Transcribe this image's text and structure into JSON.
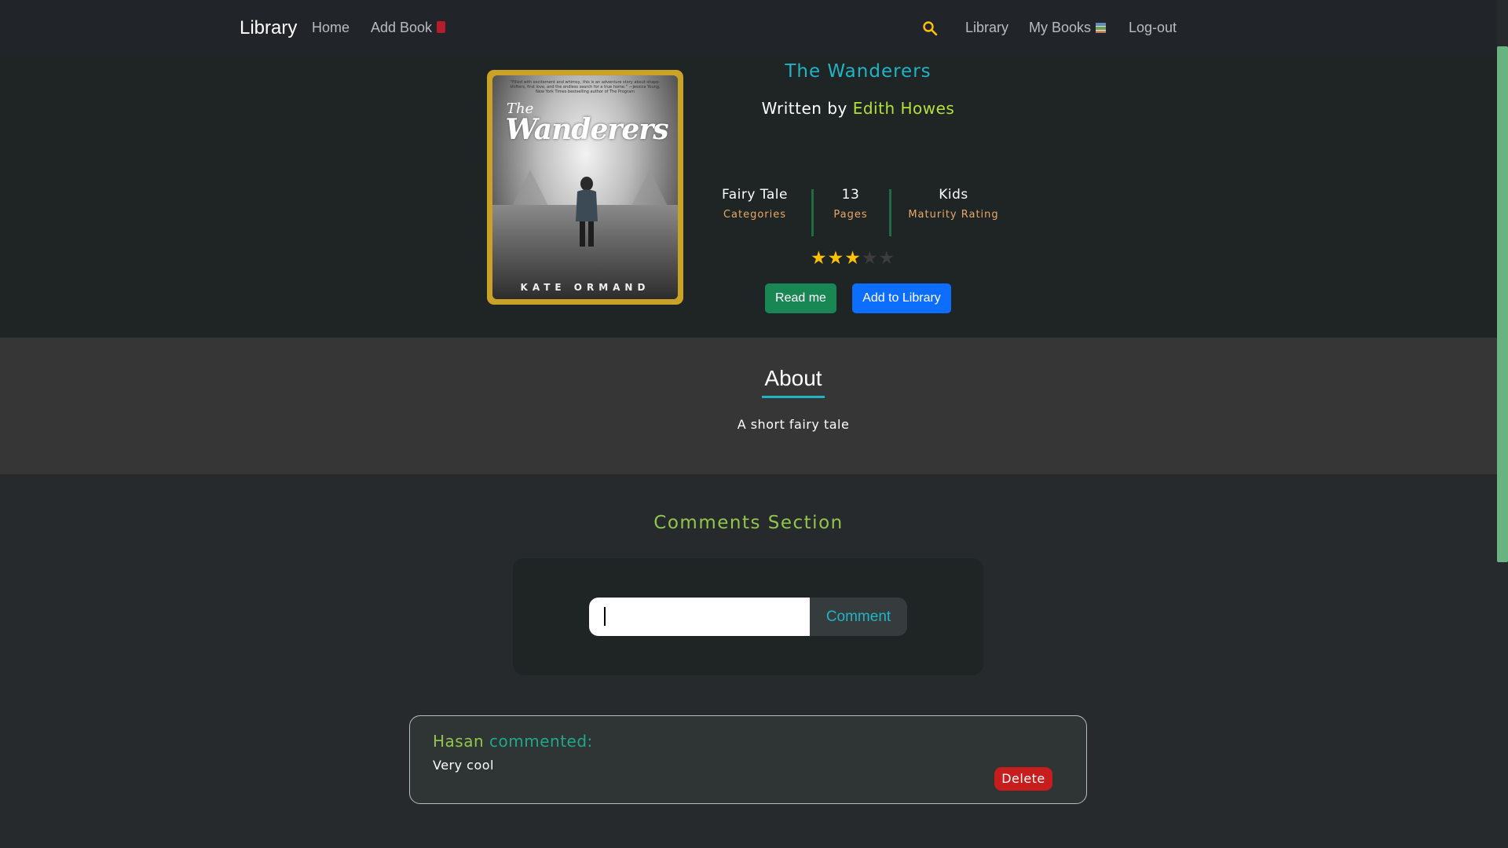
{
  "navbar": {
    "brand": "Library",
    "home": "Home",
    "add_book": "Add Book",
    "library": "Library",
    "my_books": "My Books",
    "logout": "Log-out",
    "search_icon": "search-icon",
    "accent_color": "#ffc107"
  },
  "book": {
    "cover": {
      "blurb": "\"Filled with excitement and whimsy, this is an adventure story about shape-shifters, first love, and the endless search for a true home.\" —Jessica Young, New York Times bestselling author of The Program",
      "title_prefix": "The",
      "title": "Wanderers",
      "author": "KATE ORMAND"
    },
    "title": "The Wanderers",
    "written_by_prefix": "Written by",
    "author": "Edith Howes",
    "stats": {
      "category_value": "Fairy Tale",
      "category_label": "Categories",
      "pages_value": "13",
      "pages_label": "Pages",
      "maturity_value": "Kids",
      "maturity_label": "Maturity Rating"
    },
    "rating": {
      "filled": 3,
      "max": 5
    },
    "read_button": "Read me",
    "add_button": "Add to Library"
  },
  "about": {
    "title": "About",
    "text": "A short fairy tale"
  },
  "comments": {
    "title": "Comments Section",
    "input_value": "",
    "button": "Comment",
    "items": [
      {
        "user": "Hasan",
        "action": "commented:",
        "text": "Very cool",
        "delete": "Delete"
      }
    ]
  },
  "colors": {
    "title_teal": "#1fb5c4",
    "author_lime": "#b4e23a",
    "read_green": "#198754",
    "add_blue": "#0d6efd",
    "delete_red": "#c81d1d"
  }
}
